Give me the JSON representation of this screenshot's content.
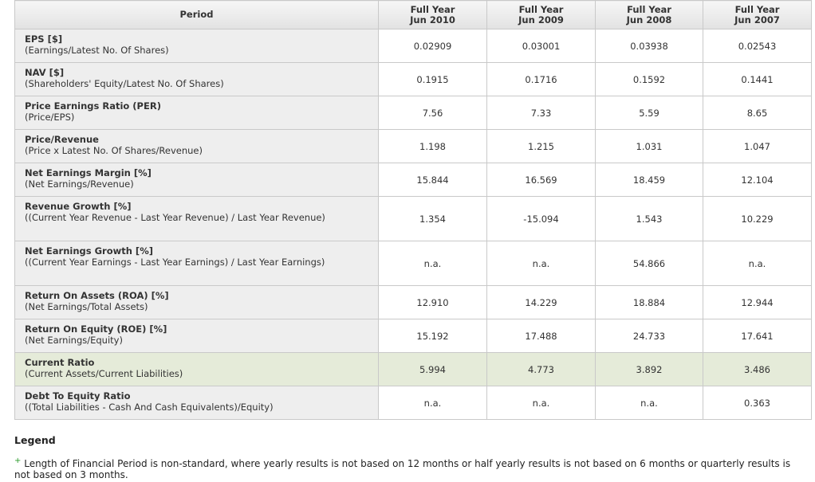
{
  "table": {
    "header_period": "Period",
    "columns": [
      {
        "line1": "Full Year",
        "line2": "Jun 2010"
      },
      {
        "line1": "Full Year",
        "line2": "Jun 2009"
      },
      {
        "line1": "Full Year",
        "line2": "Jun 2008"
      },
      {
        "line1": "Full Year",
        "line2": "Jun 2007"
      }
    ],
    "rows": [
      {
        "title": "EPS [$]",
        "desc": "(Earnings/Latest No. Of Shares)",
        "values": [
          "0.02909",
          "0.03001",
          "0.03938",
          "0.02543"
        ]
      },
      {
        "title": "NAV [$]",
        "desc": "(Shareholders' Equity/Latest No. Of Shares)",
        "values": [
          "0.1915",
          "0.1716",
          "0.1592",
          "0.1441"
        ]
      },
      {
        "title": "Price Earnings Ratio (PER)",
        "desc": "(Price/EPS)",
        "values": [
          "7.56",
          "7.33",
          "5.59",
          "8.65"
        ]
      },
      {
        "title": "Price/Revenue",
        "desc": "(Price x Latest No. Of Shares/Revenue)",
        "values": [
          "1.198",
          "1.215",
          "1.031",
          "1.047"
        ]
      },
      {
        "title": "Net Earnings Margin [%]",
        "desc": "(Net Earnings/Revenue)",
        "values": [
          "15.844",
          "16.569",
          "18.459",
          "12.104"
        ]
      },
      {
        "title": "Revenue Growth [%]",
        "desc": "((Current Year Revenue - Last Year Revenue) / Last Year Revenue)",
        "values": [
          "1.354",
          "-15.094",
          "1.543",
          "10.229"
        ]
      },
      {
        "title": "Net Earnings Growth [%]",
        "desc": "((Current Year Earnings - Last Year Earnings) / Last Year Earnings)",
        "values": [
          "n.a.",
          "n.a.",
          "54.866",
          "n.a."
        ]
      },
      {
        "title": "Return On Assets (ROA) [%]",
        "desc": "(Net Earnings/Total Assets)",
        "values": [
          "12.910",
          "14.229",
          "18.884",
          "12.944"
        ]
      },
      {
        "title": "Return On Equity (ROE) [%]",
        "desc": "(Net Earnings/Equity)",
        "values": [
          "15.192",
          "17.488",
          "24.733",
          "17.641"
        ]
      },
      {
        "title": "Current Ratio",
        "desc": "(Current Assets/Current Liabilities)",
        "values": [
          "5.994",
          "4.773",
          "3.892",
          "3.486"
        ],
        "highlight": true
      },
      {
        "title": "Debt To Equity Ratio",
        "desc": "((Total Liabilities - Cash And Cash Equivalents)/Equity)",
        "values": [
          "n.a.",
          "n.a.",
          "n.a.",
          "0.363"
        ]
      }
    ]
  },
  "legend": {
    "title": "Legend",
    "symbol": "+",
    "note": "Length of Financial Period is non-standard, where yearly results is not based on 12 months or half yearly results is not based on 6 months or quarterly results is not based on 3 months."
  },
  "colors": {
    "highlight_row": "#e5ebd9",
    "label_bg": "#eeeeee",
    "legend_symbol": "#2a9a2a"
  }
}
